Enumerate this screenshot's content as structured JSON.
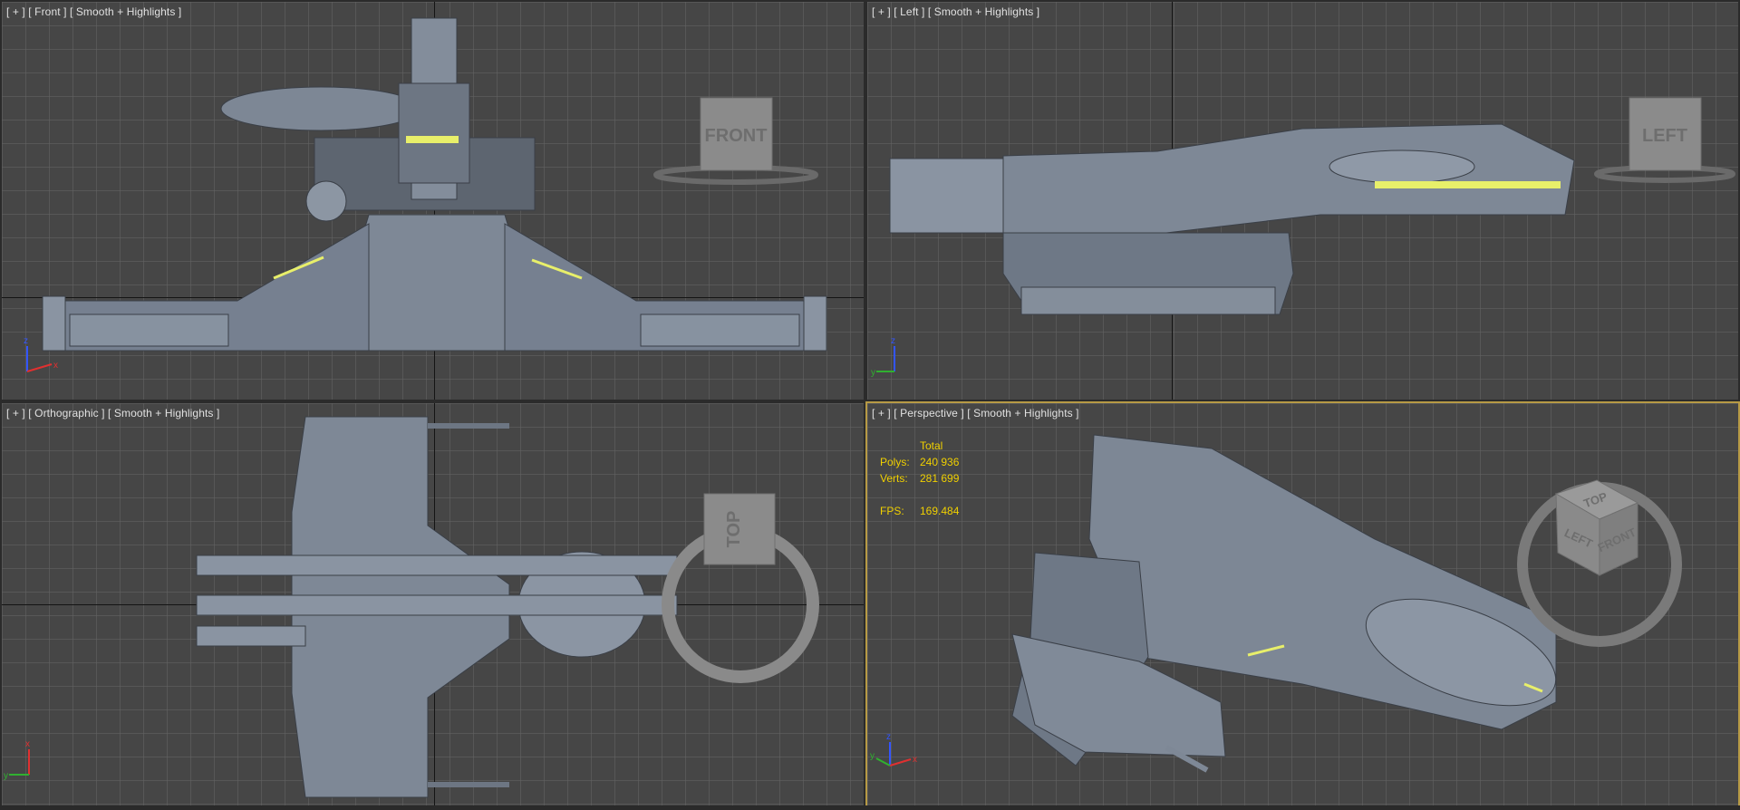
{
  "viewports": {
    "front": {
      "label": "[ + ] [ Front ] [ Smooth + Highlights ]",
      "cube_label": "FRONT"
    },
    "left": {
      "label": "[ + ] [ Left ] [ Smooth + Highlights ]",
      "cube_label": "LEFT"
    },
    "top": {
      "label": "[ + ] [ Orthographic ] [ Smooth + Highlights ]",
      "cube_label": "TOP"
    },
    "perspective": {
      "label": "[ + ] [ Perspective ] [ Smooth + Highlights ]",
      "cube_labels": {
        "top": "TOP",
        "left": "LEFT",
        "front": "FRONT"
      },
      "stats": {
        "header": "Total",
        "polys_label": "Polys:",
        "polys_value": "240 936",
        "verts_label": "Verts:",
        "verts_value": "281 699",
        "fps_label": "FPS:",
        "fps_value": "169.484"
      }
    }
  },
  "axis_tripod": {
    "x": "x",
    "y": "y",
    "z": "z"
  },
  "colors": {
    "viewport_bg": "#464646",
    "grid_line": "#646464",
    "active_border": "#b79a45",
    "stats_text": "#f0d000",
    "model": "#7e8896",
    "glow": "#e8ef6a"
  }
}
